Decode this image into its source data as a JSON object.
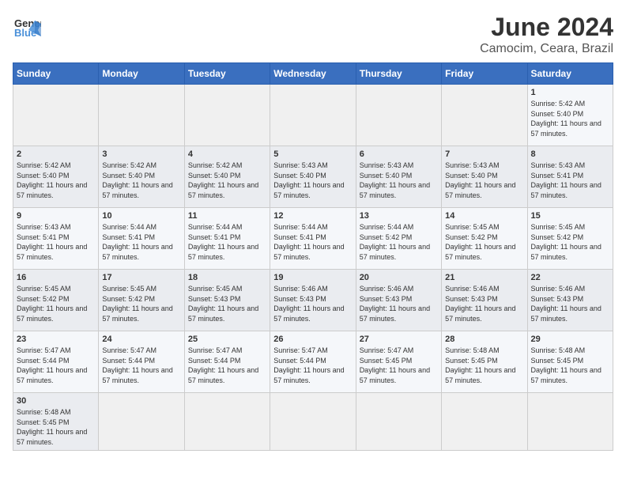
{
  "header": {
    "logo_general": "General",
    "logo_blue": "Blue",
    "title": "June 2024",
    "subtitle": "Camocim, Ceara, Brazil"
  },
  "weekdays": [
    "Sunday",
    "Monday",
    "Tuesday",
    "Wednesday",
    "Thursday",
    "Friday",
    "Saturday"
  ],
  "weeks": [
    [
      {
        "day": "",
        "sunrise": "",
        "sunset": "",
        "daylight": ""
      },
      {
        "day": "",
        "sunrise": "",
        "sunset": "",
        "daylight": ""
      },
      {
        "day": "",
        "sunrise": "",
        "sunset": "",
        "daylight": ""
      },
      {
        "day": "",
        "sunrise": "",
        "sunset": "",
        "daylight": ""
      },
      {
        "day": "",
        "sunrise": "",
        "sunset": "",
        "daylight": ""
      },
      {
        "day": "",
        "sunrise": "",
        "sunset": "",
        "daylight": ""
      },
      {
        "day": "1",
        "sunrise": "Sunrise: 5:42 AM",
        "sunset": "Sunset: 5:40 PM",
        "daylight": "Daylight: 11 hours and 57 minutes."
      }
    ],
    [
      {
        "day": "2",
        "sunrise": "Sunrise: 5:42 AM",
        "sunset": "Sunset: 5:40 PM",
        "daylight": "Daylight: 11 hours and 57 minutes."
      },
      {
        "day": "3",
        "sunrise": "Sunrise: 5:42 AM",
        "sunset": "Sunset: 5:40 PM",
        "daylight": "Daylight: 11 hours and 57 minutes."
      },
      {
        "day": "4",
        "sunrise": "Sunrise: 5:42 AM",
        "sunset": "Sunset: 5:40 PM",
        "daylight": "Daylight: 11 hours and 57 minutes."
      },
      {
        "day": "5",
        "sunrise": "Sunrise: 5:43 AM",
        "sunset": "Sunset: 5:40 PM",
        "daylight": "Daylight: 11 hours and 57 minutes."
      },
      {
        "day": "6",
        "sunrise": "Sunrise: 5:43 AM",
        "sunset": "Sunset: 5:40 PM",
        "daylight": "Daylight: 11 hours and 57 minutes."
      },
      {
        "day": "7",
        "sunrise": "Sunrise: 5:43 AM",
        "sunset": "Sunset: 5:40 PM",
        "daylight": "Daylight: 11 hours and 57 minutes."
      },
      {
        "day": "8",
        "sunrise": "Sunrise: 5:43 AM",
        "sunset": "Sunset: 5:41 PM",
        "daylight": "Daylight: 11 hours and 57 minutes."
      }
    ],
    [
      {
        "day": "9",
        "sunrise": "Sunrise: 5:43 AM",
        "sunset": "Sunset: 5:41 PM",
        "daylight": "Daylight: 11 hours and 57 minutes."
      },
      {
        "day": "10",
        "sunrise": "Sunrise: 5:44 AM",
        "sunset": "Sunset: 5:41 PM",
        "daylight": "Daylight: 11 hours and 57 minutes."
      },
      {
        "day": "11",
        "sunrise": "Sunrise: 5:44 AM",
        "sunset": "Sunset: 5:41 PM",
        "daylight": "Daylight: 11 hours and 57 minutes."
      },
      {
        "day": "12",
        "sunrise": "Sunrise: 5:44 AM",
        "sunset": "Sunset: 5:41 PM",
        "daylight": "Daylight: 11 hours and 57 minutes."
      },
      {
        "day": "13",
        "sunrise": "Sunrise: 5:44 AM",
        "sunset": "Sunset: 5:42 PM",
        "daylight": "Daylight: 11 hours and 57 minutes."
      },
      {
        "day": "14",
        "sunrise": "Sunrise: 5:45 AM",
        "sunset": "Sunset: 5:42 PM",
        "daylight": "Daylight: 11 hours and 57 minutes."
      },
      {
        "day": "15",
        "sunrise": "Sunrise: 5:45 AM",
        "sunset": "Sunset: 5:42 PM",
        "daylight": "Daylight: 11 hours and 57 minutes."
      }
    ],
    [
      {
        "day": "16",
        "sunrise": "Sunrise: 5:45 AM",
        "sunset": "Sunset: 5:42 PM",
        "daylight": "Daylight: 11 hours and 57 minutes."
      },
      {
        "day": "17",
        "sunrise": "Sunrise: 5:45 AM",
        "sunset": "Sunset: 5:42 PM",
        "daylight": "Daylight: 11 hours and 57 minutes."
      },
      {
        "day": "18",
        "sunrise": "Sunrise: 5:45 AM",
        "sunset": "Sunset: 5:43 PM",
        "daylight": "Daylight: 11 hours and 57 minutes."
      },
      {
        "day": "19",
        "sunrise": "Sunrise: 5:46 AM",
        "sunset": "Sunset: 5:43 PM",
        "daylight": "Daylight: 11 hours and 57 minutes."
      },
      {
        "day": "20",
        "sunrise": "Sunrise: 5:46 AM",
        "sunset": "Sunset: 5:43 PM",
        "daylight": "Daylight: 11 hours and 57 minutes."
      },
      {
        "day": "21",
        "sunrise": "Sunrise: 5:46 AM",
        "sunset": "Sunset: 5:43 PM",
        "daylight": "Daylight: 11 hours and 57 minutes."
      },
      {
        "day": "22",
        "sunrise": "Sunrise: 5:46 AM",
        "sunset": "Sunset: 5:43 PM",
        "daylight": "Daylight: 11 hours and 57 minutes."
      }
    ],
    [
      {
        "day": "23",
        "sunrise": "Sunrise: 5:47 AM",
        "sunset": "Sunset: 5:44 PM",
        "daylight": "Daylight: 11 hours and 57 minutes."
      },
      {
        "day": "24",
        "sunrise": "Sunrise: 5:47 AM",
        "sunset": "Sunset: 5:44 PM",
        "daylight": "Daylight: 11 hours and 57 minutes."
      },
      {
        "day": "25",
        "sunrise": "Sunrise: 5:47 AM",
        "sunset": "Sunset: 5:44 PM",
        "daylight": "Daylight: 11 hours and 57 minutes."
      },
      {
        "day": "26",
        "sunrise": "Sunrise: 5:47 AM",
        "sunset": "Sunset: 5:44 PM",
        "daylight": "Daylight: 11 hours and 57 minutes."
      },
      {
        "day": "27",
        "sunrise": "Sunrise: 5:47 AM",
        "sunset": "Sunset: 5:45 PM",
        "daylight": "Daylight: 11 hours and 57 minutes."
      },
      {
        "day": "28",
        "sunrise": "Sunrise: 5:48 AM",
        "sunset": "Sunset: 5:45 PM",
        "daylight": "Daylight: 11 hours and 57 minutes."
      },
      {
        "day": "29",
        "sunrise": "Sunrise: 5:48 AM",
        "sunset": "Sunset: 5:45 PM",
        "daylight": "Daylight: 11 hours and 57 minutes."
      }
    ],
    [
      {
        "day": "30",
        "sunrise": "Sunrise: 5:48 AM",
        "sunset": "Sunset: 5:45 PM",
        "daylight": "Daylight: 11 hours and 57 minutes."
      },
      {
        "day": "",
        "sunrise": "",
        "sunset": "",
        "daylight": ""
      },
      {
        "day": "",
        "sunrise": "",
        "sunset": "",
        "daylight": ""
      },
      {
        "day": "",
        "sunrise": "",
        "sunset": "",
        "daylight": ""
      },
      {
        "day": "",
        "sunrise": "",
        "sunset": "",
        "daylight": ""
      },
      {
        "day": "",
        "sunrise": "",
        "sunset": "",
        "daylight": ""
      },
      {
        "day": "",
        "sunrise": "",
        "sunset": "",
        "daylight": ""
      }
    ]
  ]
}
